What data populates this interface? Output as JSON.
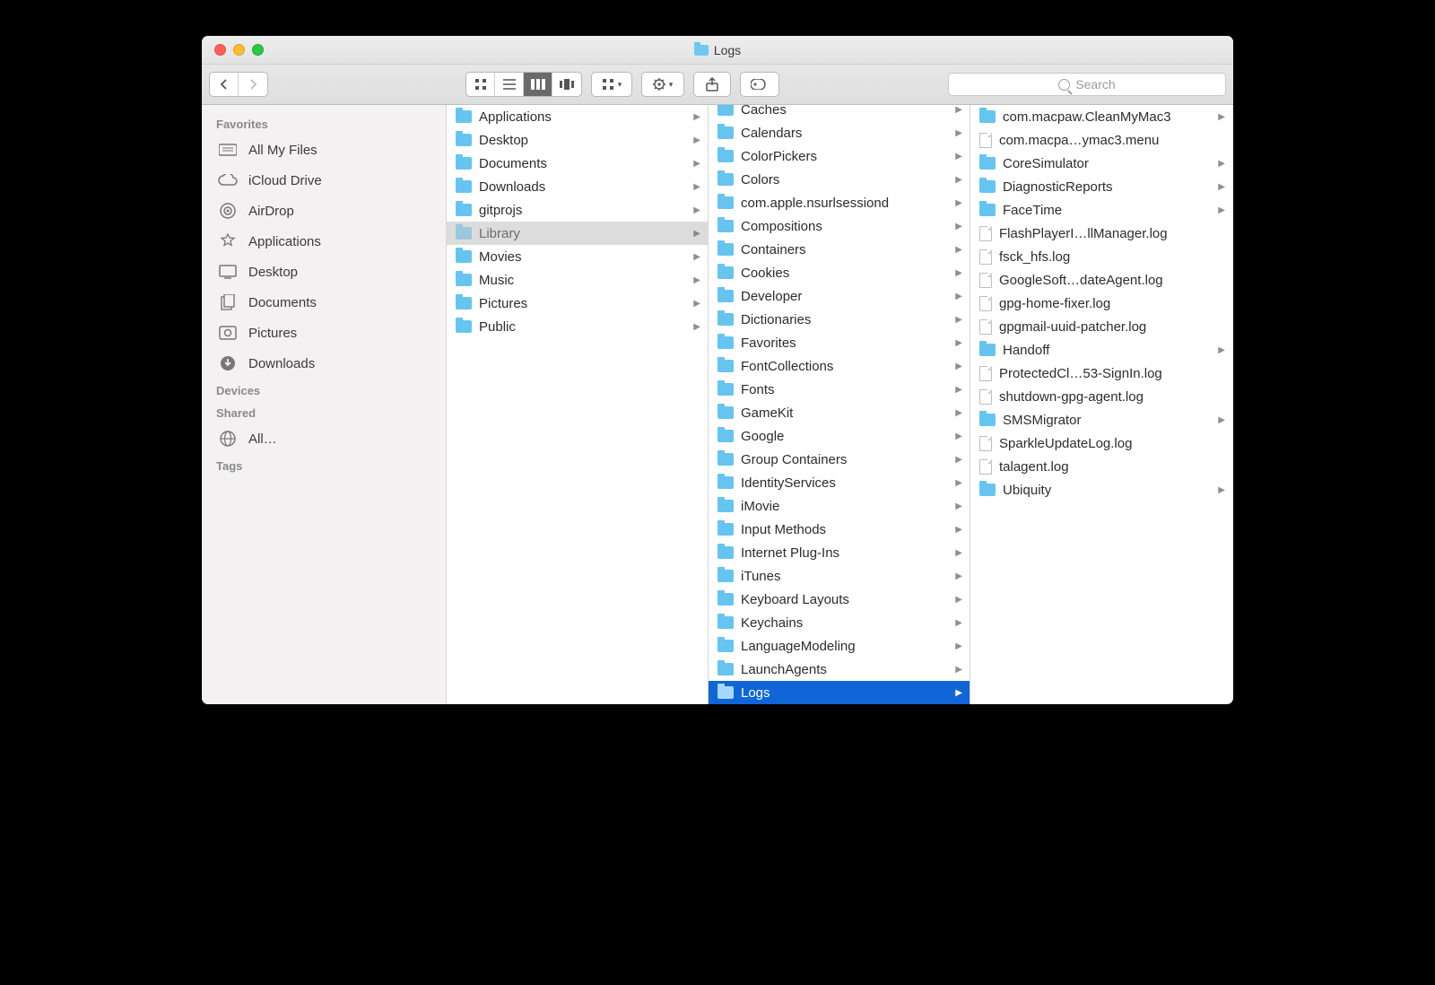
{
  "window": {
    "title": "Logs"
  },
  "toolbar": {
    "search_placeholder": "Search"
  },
  "sidebar": {
    "section_favorites": "Favorites",
    "section_devices": "Devices",
    "section_shared": "Shared",
    "section_tags": "Tags",
    "favorites": [
      {
        "label": "All My Files",
        "icon": "all-files-icon"
      },
      {
        "label": "iCloud Drive",
        "icon": "cloud-icon"
      },
      {
        "label": "AirDrop",
        "icon": "airdrop-icon"
      },
      {
        "label": "Applications",
        "icon": "applications-icon"
      },
      {
        "label": "Desktop",
        "icon": "desktop-icon"
      },
      {
        "label": "Documents",
        "icon": "documents-icon"
      },
      {
        "label": "Pictures",
        "icon": "pictures-icon"
      },
      {
        "label": "Downloads",
        "icon": "downloads-icon"
      }
    ],
    "shared": [
      {
        "label": "All…",
        "icon": "network-icon"
      }
    ]
  },
  "columns": [
    {
      "items": [
        {
          "label": "Applications",
          "type": "folder",
          "hasChildren": true
        },
        {
          "label": "Desktop",
          "type": "folder",
          "hasChildren": true
        },
        {
          "label": "Documents",
          "type": "folder",
          "hasChildren": true
        },
        {
          "label": "Downloads",
          "type": "folder",
          "hasChildren": true
        },
        {
          "label": "gitprojs",
          "type": "folder",
          "hasChildren": true
        },
        {
          "label": "Library",
          "type": "folder",
          "hasChildren": true,
          "selected": "grey"
        },
        {
          "label": "Movies",
          "type": "folder",
          "hasChildren": true
        },
        {
          "label": "Music",
          "type": "folder",
          "hasChildren": true
        },
        {
          "label": "Pictures",
          "type": "folder",
          "hasChildren": true
        },
        {
          "label": "Public",
          "type": "folder",
          "hasChildren": true
        }
      ]
    },
    {
      "items": [
        {
          "label": "Caches",
          "type": "folder",
          "hasChildren": true
        },
        {
          "label": "Calendars",
          "type": "folder",
          "hasChildren": true
        },
        {
          "label": "ColorPickers",
          "type": "folder",
          "hasChildren": true
        },
        {
          "label": "Colors",
          "type": "folder",
          "hasChildren": true
        },
        {
          "label": "com.apple.nsurlsessiond",
          "type": "folder",
          "hasChildren": true
        },
        {
          "label": "Compositions",
          "type": "folder",
          "hasChildren": true
        },
        {
          "label": "Containers",
          "type": "folder",
          "hasChildren": true
        },
        {
          "label": "Cookies",
          "type": "folder",
          "hasChildren": true
        },
        {
          "label": "Developer",
          "type": "folder",
          "hasChildren": true
        },
        {
          "label": "Dictionaries",
          "type": "folder",
          "hasChildren": true
        },
        {
          "label": "Favorites",
          "type": "folder",
          "hasChildren": true
        },
        {
          "label": "FontCollections",
          "type": "folder",
          "hasChildren": true
        },
        {
          "label": "Fonts",
          "type": "folder",
          "hasChildren": true
        },
        {
          "label": "GameKit",
          "type": "folder",
          "hasChildren": true
        },
        {
          "label": "Google",
          "type": "folder",
          "hasChildren": true
        },
        {
          "label": "Group Containers",
          "type": "folder",
          "hasChildren": true
        },
        {
          "label": "IdentityServices",
          "type": "folder",
          "hasChildren": true
        },
        {
          "label": "iMovie",
          "type": "folder",
          "hasChildren": true
        },
        {
          "label": "Input Methods",
          "type": "folder",
          "hasChildren": true
        },
        {
          "label": "Internet Plug-Ins",
          "type": "folder",
          "hasChildren": true
        },
        {
          "label": "iTunes",
          "type": "folder",
          "hasChildren": true
        },
        {
          "label": "Keyboard Layouts",
          "type": "folder",
          "hasChildren": true
        },
        {
          "label": "Keychains",
          "type": "folder",
          "hasChildren": true
        },
        {
          "label": "LanguageModeling",
          "type": "folder",
          "hasChildren": true
        },
        {
          "label": "LaunchAgents",
          "type": "folder",
          "hasChildren": true
        },
        {
          "label": "Logs",
          "type": "folder",
          "hasChildren": true,
          "selected": "blue"
        }
      ]
    },
    {
      "items": [
        {
          "label": "com.macpaw.CleanMyMac3",
          "type": "folder",
          "hasChildren": true
        },
        {
          "label": "com.macpa…ymac3.menu",
          "type": "file"
        },
        {
          "label": "CoreSimulator",
          "type": "folder",
          "hasChildren": true
        },
        {
          "label": "DiagnosticReports",
          "type": "folder",
          "hasChildren": true
        },
        {
          "label": "FaceTime",
          "type": "folder",
          "hasChildren": true
        },
        {
          "label": "FlashPlayerI…llManager.log",
          "type": "file"
        },
        {
          "label": "fsck_hfs.log",
          "type": "file"
        },
        {
          "label": "GoogleSoft…dateAgent.log",
          "type": "file"
        },
        {
          "label": "gpg-home-fixer.log",
          "type": "file"
        },
        {
          "label": "gpgmail-uuid-patcher.log",
          "type": "file"
        },
        {
          "label": "Handoff",
          "type": "folder",
          "hasChildren": true
        },
        {
          "label": "ProtectedCl…53-SignIn.log",
          "type": "file"
        },
        {
          "label": "shutdown-gpg-agent.log",
          "type": "file"
        },
        {
          "label": "SMSMigrator",
          "type": "folder",
          "hasChildren": true
        },
        {
          "label": "SparkleUpdateLog.log",
          "type": "file"
        },
        {
          "label": "talagent.log",
          "type": "file"
        },
        {
          "label": "Ubiquity",
          "type": "folder",
          "hasChildren": true
        }
      ]
    }
  ]
}
